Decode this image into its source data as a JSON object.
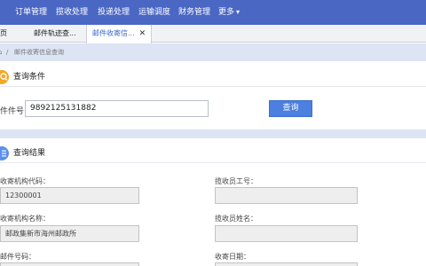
{
  "topnav": {
    "items": [
      "订单管理",
      "揽收处理",
      "投递处理",
      "运输调度",
      "财务管理",
      "更多"
    ],
    "more_arrow": "▾",
    "bg_color": "#4b67c4"
  },
  "tabs": {
    "items": [
      "页",
      "邮件轨迹查...",
      "邮件收寄信..."
    ],
    "close_glyph": "✕"
  },
  "breadcrumb": {
    "home_glyph": "⌂",
    "separator": "/",
    "current": "邮件收寄信息查询"
  },
  "query": {
    "title": "查询条件",
    "icon": "search-icon",
    "icon_color": "#f5a623",
    "mail_no_label": "件件号:",
    "mail_no_value": "9892125131882",
    "search_button": "查询",
    "button_color": "#4b7fe0"
  },
  "results": {
    "title": "查询结果",
    "icon": "list-icon",
    "icon_color": "#5b8def",
    "fields": {
      "org_code_label": "收寄机构代码：",
      "org_code_value": "12300001",
      "collector_no_label": "揽收员工号：",
      "collector_no_value": "",
      "org_name_label": "收寄机构名称：",
      "org_name_value": "邮政集新市海州邮政所",
      "collector_name_label": "揽收员姓名：",
      "collector_name_value": "",
      "mail_no_label": "邮件号码：",
      "date_label": "收寄日期："
    }
  }
}
